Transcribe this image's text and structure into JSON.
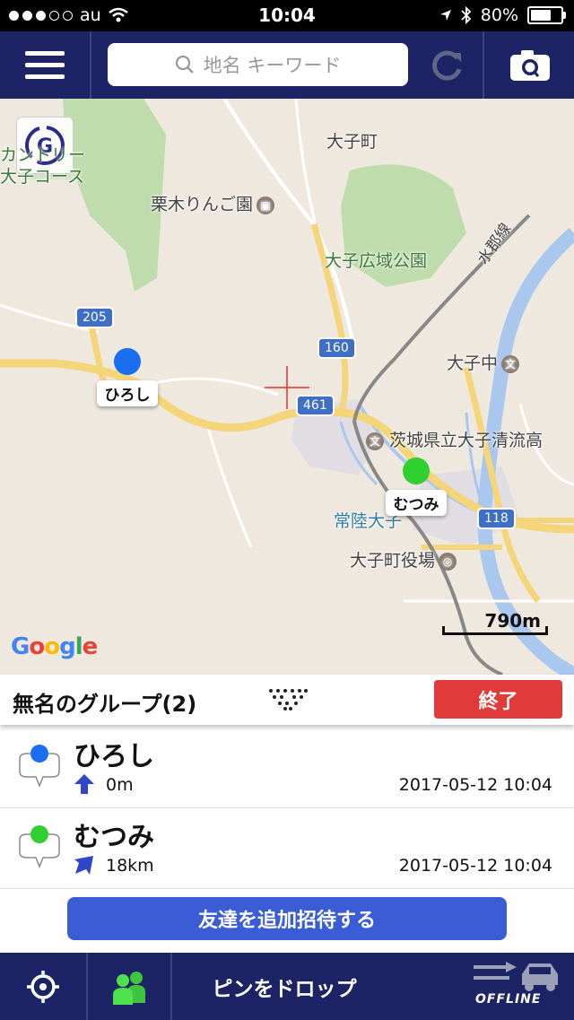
{
  "status_bar": {
    "carrier": "au",
    "time": "10:04",
    "battery": "80%",
    "battery_level": 0.8
  },
  "header": {
    "search_placeholder": "地名 キーワード"
  },
  "map": {
    "labels": {
      "town": "大子町",
      "orchard": "栗木りんご園",
      "park": "大子広域公園",
      "line": "水郡線",
      "school_mid": "大子中",
      "school_high": "茨城県立大子清流高",
      "station": "常陸大子",
      "office": "大子町役場",
      "partial_top_left": "カントリー",
      "partial_top_left2": "大子コース"
    },
    "routes": [
      "205",
      "160",
      "461",
      "118"
    ],
    "pins": [
      {
        "name": "ひろし",
        "color": "#1a6ff0"
      },
      {
        "name": "むつみ",
        "color": "#2fd02f"
      }
    ],
    "scale": "790m",
    "attribution": "Google"
  },
  "group": {
    "title": "無名のグループ(2)",
    "end_label": "終了"
  },
  "members": [
    {
      "name": "ひろし",
      "distance": "0m",
      "timestamp": "2017-05-12  10:04",
      "color": "#1a6ff0"
    },
    {
      "name": "むつみ",
      "distance": "18km",
      "timestamp": "2017-05-12  10:04",
      "color": "#2fd02f"
    }
  ],
  "invite_label": "友達を追加招待する",
  "bottom": {
    "drop_pin_label": "ピンをドロップ",
    "offline_label": "OFFLINE"
  }
}
